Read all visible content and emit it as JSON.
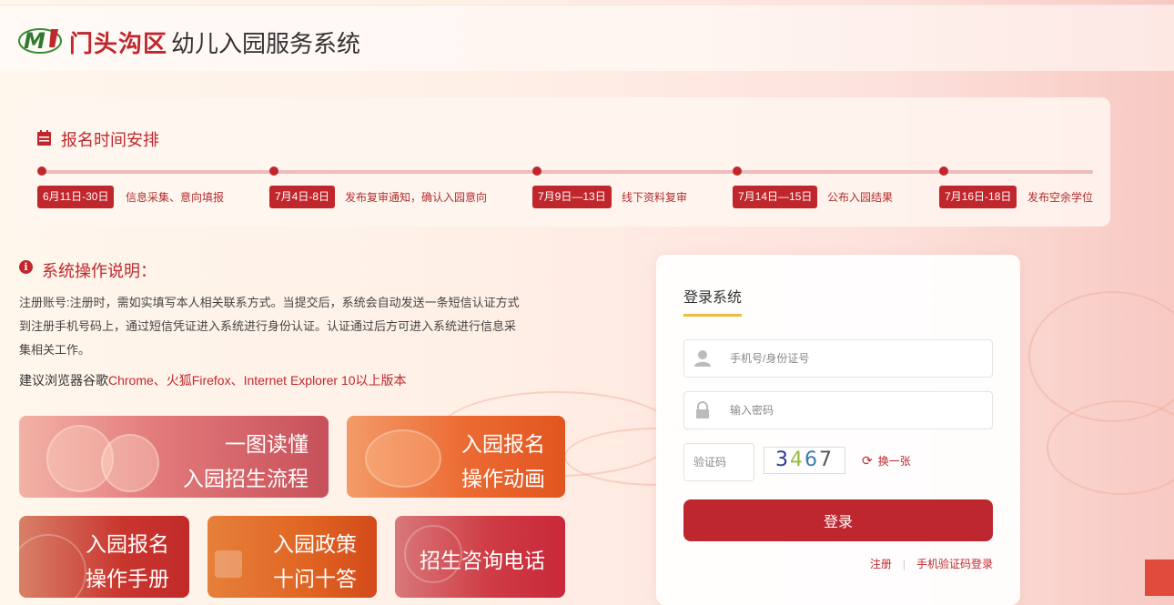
{
  "header": {
    "district": "门头沟区",
    "system_name": "幼儿入园服务系统",
    "logo_text": "M"
  },
  "schedule": {
    "title": "报名时间安排",
    "steps": [
      {
        "date": "6月11日-30日",
        "desc": "信息采集、意向填报"
      },
      {
        "date": "7月4日-8日",
        "desc": "发布复审通知，确认入园意向"
      },
      {
        "date": "7月9日—13日",
        "desc": "线下资料复审"
      },
      {
        "date": "7月14日—15日",
        "desc": "公布入园结果"
      },
      {
        "date": "7月16日-18日",
        "desc": "发布空余学位"
      }
    ]
  },
  "instructions": {
    "title": "系统操作说明：",
    "line1": "注册账号:注册时，需如实填写本人相关联系方式。当提交后，系统会自动发送一条短信认证方式",
    "line2": "到注册手机号码上，通过短信凭证进入系统进行身份认证。认证通过后方可进入系统进行信息采",
    "line3": "集相关工作。",
    "browser_prefix": "建议浏览器谷歌",
    "browser_list": "Chrome、火狐Firefox、Internet Explorer 10以上版本"
  },
  "tiles": {
    "flow": {
      "line1": "一图读懂",
      "line2": "入园招生流程"
    },
    "animation": {
      "line1": "入园报名",
      "line2": "操作动画"
    },
    "manual": {
      "line1": "入园报名",
      "line2": "操作手册"
    },
    "policy": {
      "line1": "入园政策",
      "line2": "十问十答"
    },
    "hotline": {
      "line1": "招生咨询电话"
    }
  },
  "login": {
    "title": "登录系统",
    "username_placeholder": "手机号/身份证号",
    "password_placeholder": "输入密码",
    "captcha_placeholder": "验证码",
    "captcha_chars": [
      "3",
      "4",
      "6",
      "7"
    ],
    "refresh_label": "换一张",
    "submit_label": "登录",
    "register_label": "注册",
    "sms_login_label": "手机验证码登录"
  },
  "colors": {
    "brand_red": "#c0272d",
    "accent_yellow": "#f2b83a"
  }
}
